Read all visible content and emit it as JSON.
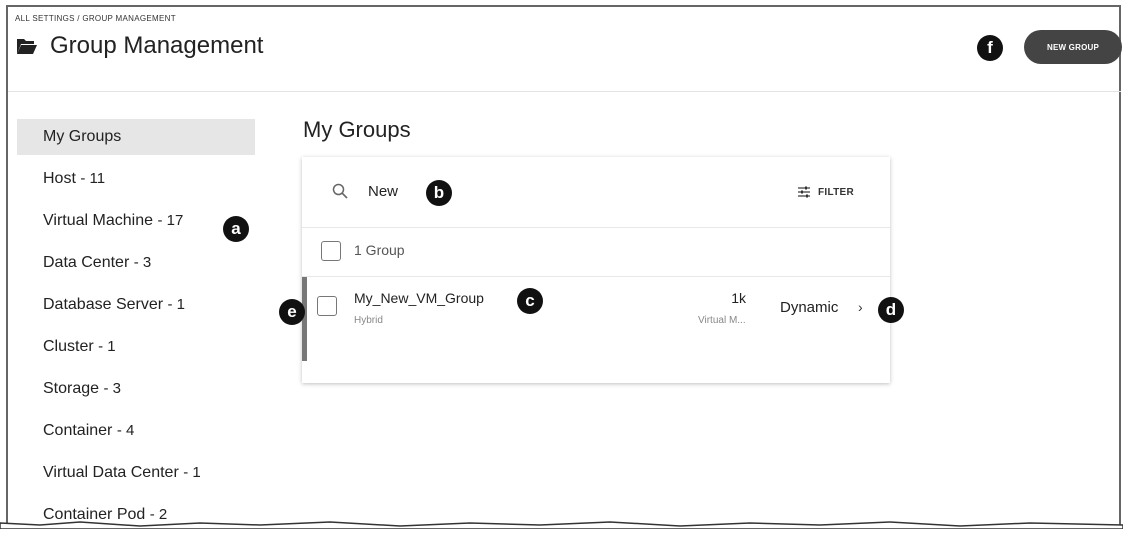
{
  "breadcrumb": "ALL SETTINGS / GROUP MANAGEMENT",
  "page_title": "Group Management",
  "new_group_label": "NEW GROUP",
  "section_title": "My Groups",
  "sidebar": {
    "items": [
      {
        "label": "My Groups",
        "count": ""
      },
      {
        "label": "Host",
        "count": "- 11"
      },
      {
        "label": "Virtual Machine",
        "count": "- 17"
      },
      {
        "label": "Data Center",
        "count": "- 3"
      },
      {
        "label": "Database Server",
        "count": "- 1"
      },
      {
        "label": "Cluster",
        "count": "- 1"
      },
      {
        "label": "Storage",
        "count": "- 3"
      },
      {
        "label": "Container",
        "count": "- 4"
      },
      {
        "label": "Virtual Data Center",
        "count": "- 1"
      },
      {
        "label": "Container Pod",
        "count": "- 2"
      }
    ]
  },
  "search": {
    "value": "New"
  },
  "filter_label": "FILTER",
  "group_count_label": "1 Group",
  "groups": [
    {
      "name": "My_New_VM_Group",
      "type": "Hybrid",
      "member_count": "1k",
      "member_type": "Virtual M...",
      "kind": "Dynamic",
      "chevron": "›"
    }
  ],
  "callouts": {
    "a": "a",
    "b": "b",
    "c": "c",
    "d": "d",
    "e": "e",
    "f": "f"
  },
  "icons": {
    "folder": "folder-open-icon",
    "search": "search-icon",
    "filter": "filter-sliders-icon",
    "chevron": "chevron-right-icon"
  },
  "colors": {
    "button_bg": "#444444",
    "active_item_bg": "#e6e6e6",
    "row_accent": "#777777",
    "callout_bg": "#111111"
  }
}
